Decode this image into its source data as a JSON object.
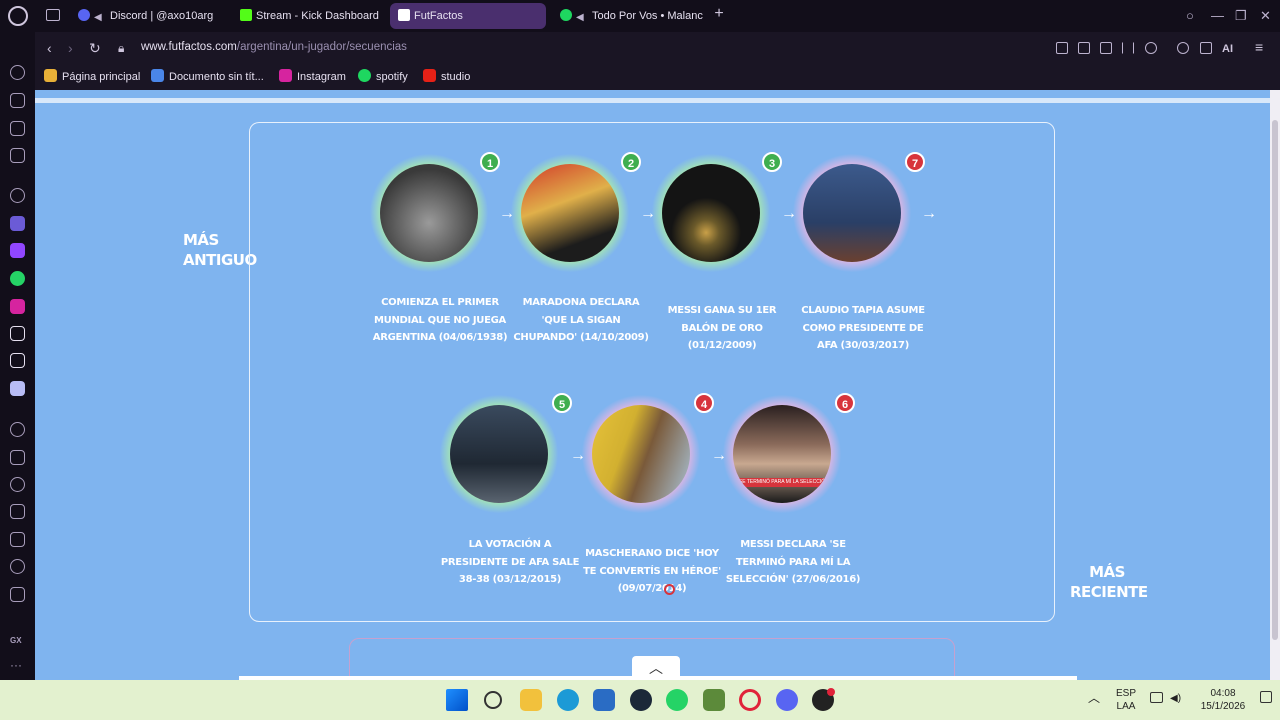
{
  "tabs": [
    {
      "label": "Discord | @axo10arg",
      "color": "#5865f2"
    },
    {
      "label": "Stream - Kick Dashboard",
      "color": "#53fc18"
    },
    {
      "label": "FutFactos",
      "color": "#ffffff"
    },
    {
      "label": "Todo Por Vos • Malanc",
      "color": "#1ed760"
    }
  ],
  "address": {
    "host": "www.futfactos.com",
    "path": "/argentina/un-jugador/secuencias"
  },
  "bookmarks": [
    {
      "label": "Página principal",
      "color": "#e8b038"
    },
    {
      "label": "Documento sin tít...",
      "color": "#4a86e8"
    },
    {
      "label": "Instagram",
      "color": "#d6249f"
    },
    {
      "label": "spotify",
      "color": "#1ed760"
    },
    {
      "label": "studio",
      "color": "#e62117"
    }
  ],
  "toolbar": {
    "ai_label": "AI"
  },
  "sequence": {
    "oldest_label": "MÁS ANTIGUO",
    "newest_label": "MÁS RECIENTE",
    "events": [
      {
        "badge": "1",
        "status": "correct",
        "text": "COMIENZA EL PRIMER MUNDIAL QUE NO JUEGA ARGENTINA (04/06/1938)"
      },
      {
        "badge": "2",
        "status": "correct",
        "text": "MARADONA DECLARA 'QUE LA SIGAN CHUPANDO' (14/10/2009)"
      },
      {
        "badge": "3",
        "status": "correct",
        "text": "MESSI GANA SU 1ER BALÓN DE ORO (01/12/2009)"
      },
      {
        "badge": "7",
        "status": "wrong",
        "text": "CLAUDIO TAPIA ASUME COMO PRESIDENTE DE AFA (30/03/2017)"
      },
      {
        "badge": "5",
        "status": "correct",
        "text": "LA VOTACIÓN A PRESIDENTE DE AFA SALE 38-38 (03/12/2015)"
      },
      {
        "badge": "4",
        "status": "wrong",
        "text": "MASCHERANO DICE 'HOY TE CONVERTÍS EN HÉROE' (09/07/2014)"
      },
      {
        "badge": "6",
        "status": "wrong",
        "text": "MESSI DECLARA 'SE TERMINÓ PARA MÍ LA SELECCIÓN' (27/06/2016)"
      }
    ],
    "caption_strip": "SE TERMINÓ PARA MÍ LA SELECCIÓ"
  },
  "taskbar": {
    "lang_top": "ESP",
    "lang_bottom": "LAA",
    "time": "04:08",
    "date": "15/1/2026"
  }
}
